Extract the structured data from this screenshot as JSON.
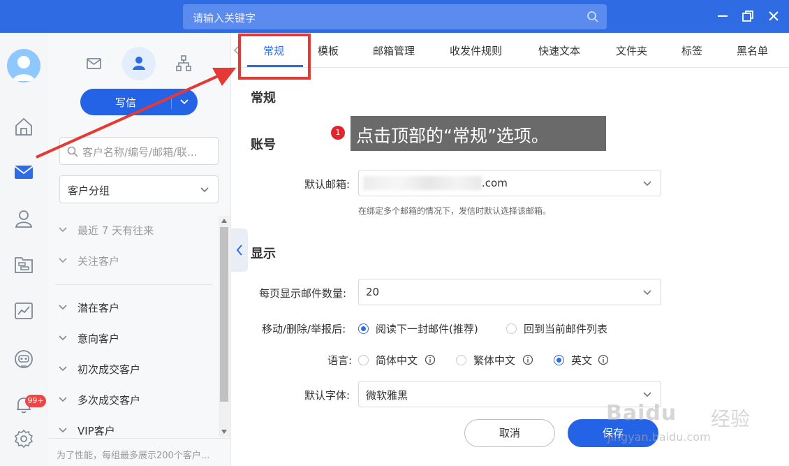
{
  "titlebar": {
    "search_placeholder": "请输入关键字"
  },
  "sidebar": {
    "notification_badge": "99+"
  },
  "customer_panel": {
    "compose_label": "写信",
    "search_placeholder": "客户名称/编号/邮箱/联...",
    "group_select": "客户分组",
    "groups": [
      {
        "label": "最近 7 天有往来"
      },
      {
        "label": "关注客户"
      },
      {
        "label": "潜在客户"
      },
      {
        "label": "意向客户"
      },
      {
        "label": "初次成交客户"
      },
      {
        "label": "多次成交客户"
      },
      {
        "label": "VIP客户"
      }
    ],
    "footnote": "为了性能，每组最多展示200个客户..."
  },
  "tabs": [
    {
      "label": "常规"
    },
    {
      "label": "模板"
    },
    {
      "label": "邮箱管理"
    },
    {
      "label": "收发件规则"
    },
    {
      "label": "快速文本"
    },
    {
      "label": "文件夹"
    },
    {
      "label": "标签"
    },
    {
      "label": "黑名单"
    }
  ],
  "settings": {
    "page_title": "常规",
    "account_section": "账号",
    "default_mailbox_label": "默认邮箱:",
    "default_mailbox_value": ".com",
    "default_mailbox_hint": "在绑定多个邮箱的情况下，发信时默认选择该邮箱。",
    "display_section": "显示",
    "per_page_label": "每页显示邮件数量:",
    "per_page_value": "20",
    "after_action_label": "移动/删除/举报后:",
    "after_action_options": [
      "阅读下一封邮件(推荐)",
      "回到当前邮件列表"
    ],
    "language_label": "语言:",
    "language_options": [
      "简体中文",
      "繁体中文",
      "英文"
    ],
    "font_label": "默认字体:",
    "font_value": "微软雅黑",
    "cancel_label": "取消",
    "save_label": "保存"
  },
  "annotation": {
    "step_number": "1",
    "callout_text": "点击顶部的“常规”选项。"
  },
  "watermark": {
    "brand": "Baidu",
    "brand_cn": "经验",
    "url": "jingyan.baidu.com"
  },
  "colors": {
    "accent": "#2f6ce4",
    "highlight": "#e53935"
  }
}
